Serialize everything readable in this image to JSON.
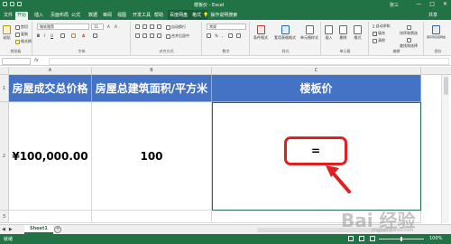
{
  "window": {
    "title": "楼板价 - Excel",
    "user": "张三",
    "tool_tab_group": "绘图工具"
  },
  "tabs": [
    "文件",
    "开始",
    "插入",
    "页面布局",
    "公式",
    "数据",
    "审阅",
    "视图",
    "开发工具",
    "帮助",
    "百度网盘",
    "格式"
  ],
  "active_tab": "开始",
  "tell_me": "操作说明搜索",
  "share": "共享",
  "ribbon": {
    "clipboard": {
      "label": "剪贴板",
      "paste": "粘贴",
      "cut": "剪切",
      "copy": "复制",
      "format_painter": "格式刷"
    },
    "font": {
      "label": "字体",
      "name": "微软雅黑",
      "size": "11"
    },
    "alignment": {
      "label": "对齐方式",
      "wrap": "自动换行",
      "merge": "合并后居中"
    },
    "number": {
      "label": "数字",
      "format": "常规"
    },
    "styles": {
      "label": "样式",
      "conditional": "条件格式",
      "table": "套用表格格式",
      "cell_styles": "单元格样式"
    },
    "cells": {
      "label": "单元格",
      "insert": "插入",
      "delete": "删除",
      "format": "格式"
    },
    "editing": {
      "label": "编辑",
      "autosum": "自动求和",
      "fill": "填充",
      "clear": "清除",
      "sort": "排序和筛选",
      "find": "查找和选择"
    },
    "save": {
      "label": "保存",
      "button": "保存到百度网盘"
    }
  },
  "formula_bar": {
    "name_box": "",
    "fx": "fx",
    "content": ""
  },
  "columns": [
    "A",
    "B",
    "C"
  ],
  "rows": [
    "1",
    "2",
    "3"
  ],
  "table": {
    "headers": [
      "房屋成交总价格",
      "房屋总建筑面积/平方米",
      "楼板价"
    ],
    "values": [
      "¥100,000.00",
      "100",
      "="
    ]
  },
  "sheets": [
    "Sheet1"
  ],
  "status": {
    "ready": "就绪",
    "zoom": "100%"
  },
  "watermark": {
    "main": "Bai 经验",
    "sub": "jingyan.baidu.com"
  }
}
